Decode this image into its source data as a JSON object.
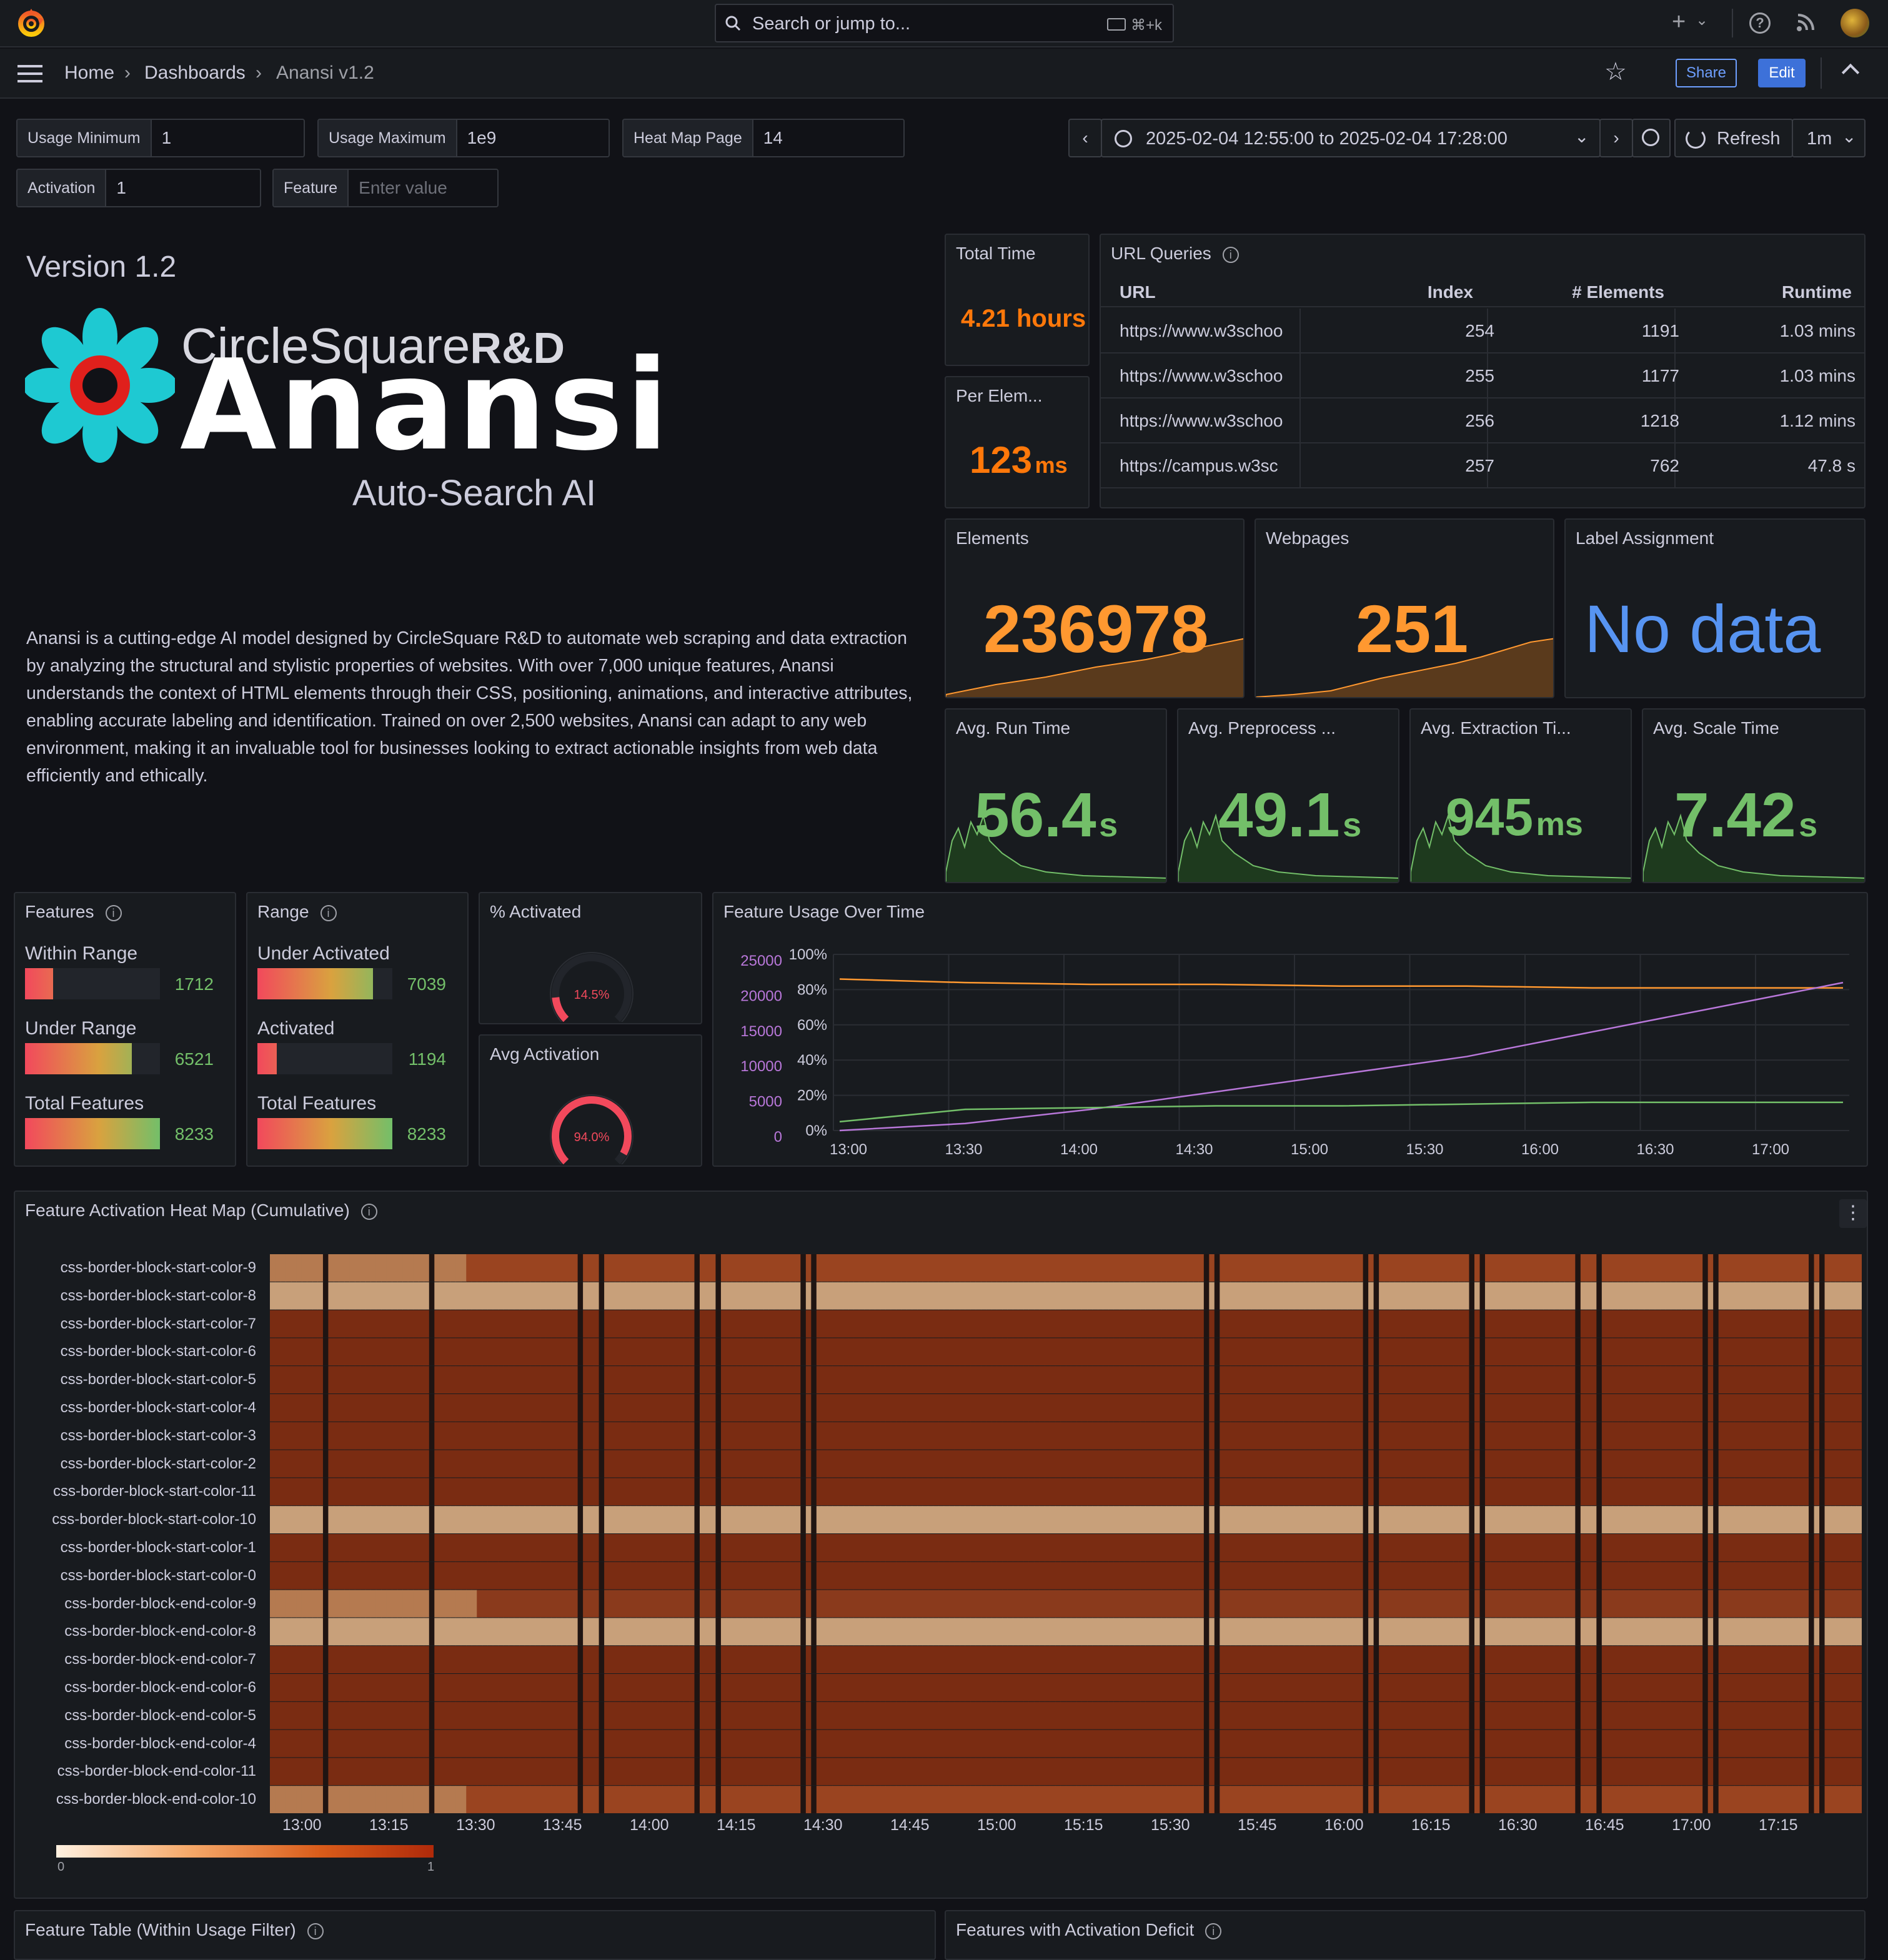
{
  "topbar": {
    "search_placeholder": "Search or jump to...",
    "shortcut": "⌘+k"
  },
  "breadcrumb": {
    "home": "Home",
    "dashboards": "Dashboards",
    "current": "Anansi v1.2"
  },
  "nav": {
    "share": "Share",
    "edit": "Edit"
  },
  "variables": [
    {
      "label": "Usage Minimum",
      "value": "1"
    },
    {
      "label": "Usage Maximum",
      "value": "1e9"
    },
    {
      "label": "Heat Map Page",
      "value": "14"
    },
    {
      "label": "Activation",
      "value": "1"
    },
    {
      "label": "Feature",
      "placeholder": "Enter value"
    }
  ],
  "timepicker": {
    "range": "2025-02-04 12:55:00 to 2025-02-04 17:28:00",
    "refresh": "Refresh",
    "interval": "1m"
  },
  "intro": {
    "version": "Version 1.2",
    "logo_company": "CircleSquare",
    "logo_rd": "R&D",
    "logo_name": "Anansi",
    "logo_tagline": "Auto-Search AI",
    "description": "Anansi is a cutting-edge AI model designed by CircleSquare R&D to automate web scraping and data extraction by analyzing the structural and stylistic properties of websites. With over 7,000 unique features, Anansi understands the context of HTML elements through their CSS, positioning, animations, and interactive attributes, enabling accurate labeling and identification. Trained on over 2,500 websites, Anansi can adapt to any web environment, making it an invaluable tool for businesses looking to extract actionable insights from web data efficiently and ethically."
  },
  "stats": {
    "total_time": {
      "title": "Total Time",
      "value": "4.21 hours",
      "color": "#ff780a"
    },
    "per_elem": {
      "title": "Per Elem...",
      "value": "123",
      "unit": "ms",
      "color": "#ff780a"
    },
    "elements": {
      "title": "Elements",
      "value": "236978",
      "color": "#ff9830"
    },
    "webpages": {
      "title": "Webpages",
      "value": "251",
      "color": "#ff9830"
    },
    "label_assignment": {
      "title": "Label Assignment",
      "value": "No data",
      "color": "#5794f2"
    },
    "avg_run": {
      "title": "Avg. Run Time",
      "value": "56.4",
      "unit": "s",
      "color": "#73bf69"
    },
    "avg_pre": {
      "title": "Avg. Preprocess ...",
      "value": "49.1",
      "unit": "s",
      "color": "#73bf69"
    },
    "avg_ext": {
      "title": "Avg. Extraction Ti...",
      "value": "945",
      "unit": "ms",
      "color": "#73bf69"
    },
    "avg_scale": {
      "title": "Avg. Scale Time",
      "value": "7.42",
      "unit": "s",
      "color": "#73bf69"
    }
  },
  "url_queries": {
    "title": "URL Queries",
    "columns": [
      "URL",
      "Index",
      "# Elements",
      "Runtime"
    ],
    "rows": [
      [
        "https://www.w3schoo",
        "254",
        "1191",
        "1.03 mins"
      ],
      [
        "https://www.w3schoo",
        "255",
        "1177",
        "1.03 mins"
      ],
      [
        "https://www.w3schoo",
        "256",
        "1218",
        "1.12 mins"
      ],
      [
        "https://campus.w3sc",
        "257",
        "762",
        "47.8 s"
      ]
    ]
  },
  "features_panel": {
    "title": "Features",
    "rows": [
      {
        "label": "Within Range",
        "value": "1712",
        "fraction": 0.208
      },
      {
        "label": "Under Range",
        "value": "6521",
        "fraction": 0.792
      },
      {
        "label": "Total Features",
        "value": "8233",
        "fraction": 1.0
      }
    ]
  },
  "range_panel": {
    "title": "Range",
    "rows": [
      {
        "label": "Under Activated",
        "value": "7039",
        "fraction": 0.855
      },
      {
        "label": "Activated",
        "value": "1194",
        "fraction": 0.145
      },
      {
        "label": "Total Features",
        "value": "8233",
        "fraction": 1.0
      }
    ]
  },
  "gauges": {
    "activated": {
      "title": "% Activated",
      "value": "14.5%",
      "fraction": 0.145
    },
    "avg_activation": {
      "title": "Avg Activation",
      "value": "94.0%",
      "fraction": 0.94
    }
  },
  "chart_data": {
    "type": "line",
    "title": "Feature Usage Over Time",
    "x": [
      "13:00",
      "13:30",
      "14:00",
      "14:30",
      "15:00",
      "15:30",
      "16:00",
      "16:30",
      "17:00"
    ],
    "y_left_ticks": [
      "25000",
      "20000",
      "15000",
      "10000",
      "5000",
      "0"
    ],
    "y_right_ticks": [
      "100%",
      "80%",
      "60%",
      "40%",
      "20%",
      "0%"
    ],
    "series": [
      {
        "color": "#ff9830",
        "values": [
          86,
          84,
          83,
          83,
          82,
          82,
          81,
          81,
          81
        ]
      },
      {
        "color": "#b877d9",
        "values": [
          0,
          4,
          12,
          22,
          32,
          42,
          56,
          70,
          84
        ]
      },
      {
        "color": "#73bf69",
        "values": [
          5,
          12,
          13,
          14,
          14,
          15,
          16,
          16,
          16
        ]
      }
    ]
  },
  "heatmap": {
    "title": "Feature Activation Heat Map (Cumulative)",
    "rows": [
      "css-border-block-start-color-9",
      "css-border-block-start-color-8",
      "css-border-block-start-color-7",
      "css-border-block-start-color-6",
      "css-border-block-start-color-5",
      "css-border-block-start-color-4",
      "css-border-block-start-color-3",
      "css-border-block-start-color-2",
      "css-border-block-start-color-11",
      "css-border-block-start-color-10",
      "css-border-block-start-color-1",
      "css-border-block-start-color-0",
      "css-border-block-end-color-9",
      "css-border-block-end-color-8",
      "css-border-block-end-color-7",
      "css-border-block-end-color-6",
      "css-border-block-end-color-5",
      "css-border-block-end-color-4",
      "css-border-block-end-color-11",
      "css-border-block-end-color-10"
    ],
    "x_labels": [
      "13:00",
      "13:15",
      "13:30",
      "13:45",
      "14:00",
      "14:15",
      "14:30",
      "14:45",
      "15:00",
      "15:15",
      "15:30",
      "15:45",
      "16:00",
      "16:15",
      "16:30",
      "16:45",
      "17:00",
      "17:15"
    ],
    "legend_min": "0",
    "legend_max": "1"
  },
  "bottom": {
    "left_title": "Feature Table (Within Usage Filter)",
    "right_title": "Features with Activation Deficit"
  }
}
